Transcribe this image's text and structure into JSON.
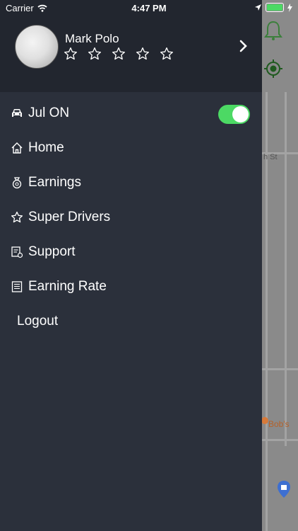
{
  "status_bar": {
    "carrier": "Carrier",
    "time": "4:47 PM"
  },
  "profile": {
    "name": "Mark Polo",
    "rating_stars": 5
  },
  "menu": {
    "duty": {
      "label": "Jul ON",
      "toggle_on": true
    },
    "items": [
      {
        "label": "Home",
        "icon": "home-icon"
      },
      {
        "label": "Earnings",
        "icon": "money-bag-icon"
      },
      {
        "label": "Super Drivers",
        "icon": "star-icon"
      },
      {
        "label": "Support",
        "icon": "support-icon"
      },
      {
        "label": "Earning Rate",
        "icon": "list-icon"
      }
    ],
    "logout": "Logout"
  },
  "map": {
    "street": "h St",
    "poi": "Bob's"
  },
  "colors": {
    "drawer": "#2b303b",
    "header": "#22262f",
    "accent": "#4cd964"
  }
}
